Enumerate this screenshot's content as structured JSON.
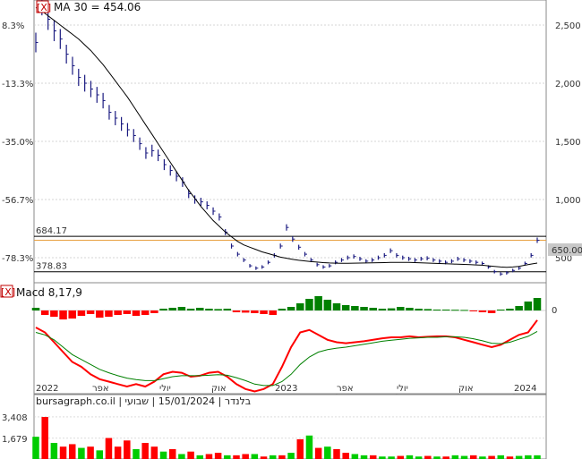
{
  "chart_data": [
    {
      "type": "line",
      "panel": "price",
      "title": "MA 30 = 454.06",
      "y_right_ticks": [
        "2,500",
        "2,000",
        "1,500",
        "1,000",
        "500"
      ],
      "y_left_ticks": [
        "8.3%",
        "-13.3%",
        "-35.0%",
        "-56.7%",
        "-78.3%"
      ],
      "ylim": [
        300,
        2700
      ],
      "grid": true,
      "reference_lines": [
        {
          "label": "684.17",
          "value": 684
        },
        {
          "label": "378.83",
          "value": 379
        }
      ],
      "last_price": {
        "label": "650.00",
        "value": 650
      },
      "series": [
        {
          "name": "price",
          "values": [
            2350,
            2680,
            2550,
            2450,
            2380,
            2250,
            2150,
            2050,
            2000,
            1950,
            1900,
            1850,
            1750,
            1700,
            1650,
            1600,
            1550,
            1480,
            1400,
            1420,
            1380,
            1300,
            1250,
            1200,
            1150,
            1050,
            1000,
            980,
            950,
            900,
            850,
            720,
            600,
            530,
            480,
            430,
            410,
            420,
            460,
            520,
            600,
            760,
            660,
            590,
            530,
            480,
            440,
            420,
            430,
            460,
            480,
            500,
            510,
            490,
            470,
            480,
            500,
            520,
            560,
            520,
            500,
            490,
            480,
            490,
            495,
            480,
            470,
            460,
            470,
            490,
            480,
            470,
            460,
            450,
            420,
            380,
            360,
            370,
            390,
            410,
            450,
            520,
            650
          ]
        },
        {
          "name": "MA 30",
          "values": [
            2650,
            2620,
            2580,
            2540,
            2500,
            2460,
            2420,
            2380,
            2330,
            2280,
            2220,
            2160,
            2090,
            2020,
            1950,
            1880,
            1800,
            1720,
            1640,
            1560,
            1480,
            1400,
            1320,
            1240,
            1160,
            1080,
            1010,
            940,
            880,
            820,
            770,
            720,
            680,
            640,
            610,
            590,
            570,
            550,
            535,
            520,
            505,
            495,
            485,
            478,
            472,
            466,
            462,
            458,
            455,
            453,
            452,
            452,
            453,
            454,
            455,
            456,
            457,
            458,
            459,
            460,
            460,
            459,
            458,
            456,
            454,
            452,
            450,
            448,
            446,
            444,
            442,
            440,
            438,
            435,
            430,
            425,
            420,
            418,
            420,
            425,
            435,
            445,
            454
          ]
        }
      ]
    },
    {
      "type": "bar",
      "panel": "macd",
      "title": "Macd 8,17,9",
      "y_right_ticks": [
        "0"
      ],
      "ylim": [
        -1,
        1
      ],
      "series": [
        {
          "name": "histogram",
          "values": [
            0.15,
            -0.25,
            -0.35,
            -0.5,
            -0.45,
            -0.3,
            -0.2,
            -0.4,
            -0.35,
            -0.25,
            -0.2,
            -0.3,
            -0.25,
            -0.15,
            0.1,
            0.15,
            0.2,
            0.1,
            0.15,
            0.1,
            0.08,
            0.1,
            -0.1,
            -0.12,
            -0.15,
            -0.2,
            -0.25,
            0.1,
            0.2,
            0.4,
            0.65,
            0.8,
            0.6,
            0.4,
            0.3,
            0.25,
            0.2,
            0.15,
            0.1,
            0.12,
            0.2,
            0.15,
            0.1,
            0.08,
            0.05,
            0.05,
            0.04,
            0.03,
            -0.05,
            -0.1,
            -0.15,
            0.05,
            0.1,
            0.25,
            0.5,
            0.7
          ]
        },
        {
          "name": "macd",
          "values": [
            0.2,
            0.1,
            -0.1,
            -0.3,
            -0.5,
            -0.6,
            -0.75,
            -0.85,
            -0.9,
            -0.95,
            -1.0,
            -0.95,
            -1.0,
            -0.9,
            -0.75,
            -0.7,
            -0.72,
            -0.8,
            -0.78,
            -0.72,
            -0.7,
            -0.8,
            -0.95,
            -1.05,
            -1.1,
            -1.05,
            -0.95,
            -0.6,
            -0.2,
            0.1,
            0.15,
            0.05,
            -0.05,
            -0.1,
            -0.12,
            -0.1,
            -0.08,
            -0.05,
            -0.02,
            0.0,
            0.0,
            0.02,
            0.0,
            0.01,
            0.02,
            0.02,
            0.0,
            -0.05,
            -0.1,
            -0.15,
            -0.2,
            -0.15,
            -0.05,
            0.05,
            0.1,
            0.35
          ]
        },
        {
          "name": "signal",
          "values": [
            0.1,
            0.05,
            -0.05,
            -0.2,
            -0.35,
            -0.45,
            -0.55,
            -0.65,
            -0.72,
            -0.78,
            -0.83,
            -0.86,
            -0.88,
            -0.88,
            -0.84,
            -0.8,
            -0.78,
            -0.78,
            -0.78,
            -0.77,
            -0.76,
            -0.77,
            -0.82,
            -0.88,
            -0.95,
            -0.98,
            -0.98,
            -0.9,
            -0.75,
            -0.55,
            -0.4,
            -0.3,
            -0.25,
            -0.22,
            -0.2,
            -0.17,
            -0.14,
            -0.11,
            -0.08,
            -0.06,
            -0.04,
            -0.02,
            -0.01,
            0.0,
            0.0,
            0.01,
            0.01,
            0.0,
            -0.03,
            -0.07,
            -0.12,
            -0.13,
            -0.1,
            -0.04,
            0.02,
            0.12
          ]
        }
      ]
    },
    {
      "type": "bar",
      "panel": "volume",
      "title": "bursagraph.co.il | בלנדר | 15/01/2024 | שבועי",
      "y_left_ticks": [
        "3,408",
        "1,679"
      ],
      "ylim": [
        0,
        4200
      ],
      "series": [
        {
          "name": "volume",
          "values": [
            1800,
            3400,
            1300,
            1000,
            1200,
            900,
            1000,
            700,
            1700,
            1000,
            1500,
            800,
            1300,
            1000,
            600,
            800,
            400,
            600,
            300,
            400,
            500,
            300,
            300,
            400,
            400,
            200,
            300,
            300,
            500,
            1600,
            1900,
            900,
            1000,
            800,
            500,
            400,
            300,
            300,
            200,
            200,
            250,
            300,
            200,
            250,
            200,
            200,
            300,
            250,
            300,
            200,
            250,
            300,
            200,
            250,
            300,
            300
          ],
          "colors": [
            "#00cc00",
            "#ff0000",
            "#00cc00",
            "#ff0000",
            "#ff0000",
            "#00cc00",
            "#ff0000",
            "#00cc00",
            "#ff0000",
            "#ff0000",
            "#ff0000",
            "#00cc00",
            "#ff0000",
            "#ff0000",
            "#00cc00",
            "#ff0000",
            "#00cc00",
            "#ff0000",
            "#00cc00",
            "#ff0000",
            "#ff0000",
            "#00cc00",
            "#ff0000",
            "#ff0000",
            "#00cc00",
            "#ff0000",
            "#00cc00",
            "#ff0000",
            "#00cc00",
            "#ff0000",
            "#00cc00",
            "#ff0000",
            "#00cc00",
            "#ff0000",
            "#ff0000",
            "#00cc00",
            "#00cc00",
            "#ff0000",
            "#00cc00",
            "#00cc00",
            "#ff0000",
            "#00cc00",
            "#00cc00",
            "#ff0000",
            "#00cc00",
            "#ff0000",
            "#00cc00",
            "#00cc00",
            "#ff0000",
            "#00cc00",
            "#ff0000",
            "#00cc00",
            "#ff0000",
            "#00cc00",
            "#00cc00",
            "#00cc00"
          ]
        }
      ]
    }
  ],
  "x_axis_ticks": [
    "2022",
    "אפר",
    "יולי",
    "אוק",
    "2023",
    "אפר",
    "יולי",
    "אוק",
    "2024"
  ],
  "close_markers": [
    "[X]",
    "[X]"
  ],
  "colors": {
    "price": "#1a1a80",
    "ma": "#000000",
    "ref_line": "#000000",
    "ref_line_orange": "#e8a040",
    "macd": "#ff0000",
    "signal": "#008000",
    "hist_pos": "#008000",
    "hist_neg": "#ff0000",
    "grid": "#c8c8c8",
    "close_box": "#c00000"
  }
}
